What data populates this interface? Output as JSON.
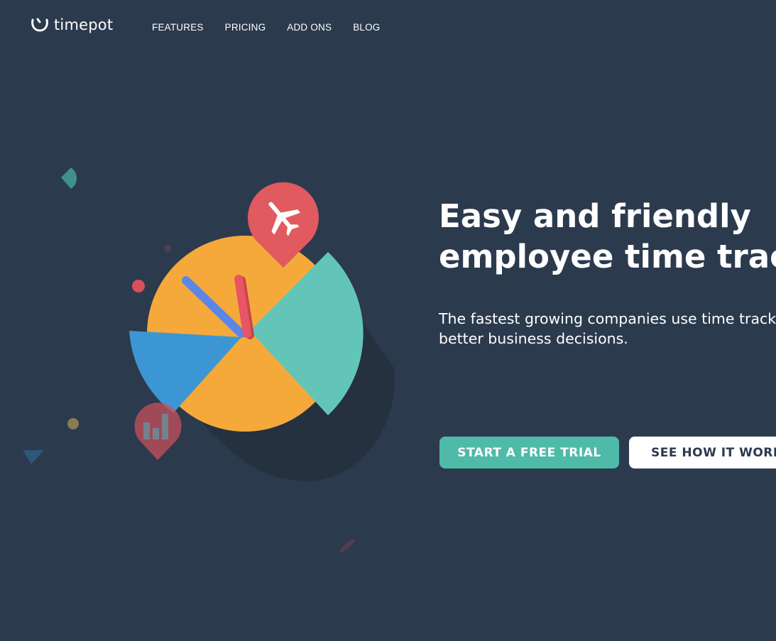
{
  "brand": {
    "name": "timepot",
    "logo_icon": "smile-pot-icon"
  },
  "nav": {
    "items": [
      {
        "label": "FEATURES"
      },
      {
        "label": "PRICING"
      },
      {
        "label": "ADD ONS"
      },
      {
        "label": "BLOG"
      }
    ]
  },
  "hero": {
    "title_line1": "Easy and friendly",
    "title_line2": "employee time tracking",
    "subtitle_line1": "The fastest growing companies use time tracking to make",
    "subtitle_line2": "better business decisions.",
    "cta_primary": "START A FREE TRIAL",
    "cta_secondary": "SEE HOW IT WORKS"
  },
  "colors": {
    "background": "#2c3a4e",
    "accent_teal": "#4fbaa8",
    "clock_yellow": "#f5a93a",
    "clock_teal": "#63c5b8",
    "clock_blue": "#3d96d4",
    "pin_red": "#e05a5f",
    "hand_blue": "#5a86e8",
    "hand_red": "#e85565"
  },
  "icons": {
    "travel_pin": "airplane-icon",
    "report_pin": "bar-chart-icon"
  }
}
